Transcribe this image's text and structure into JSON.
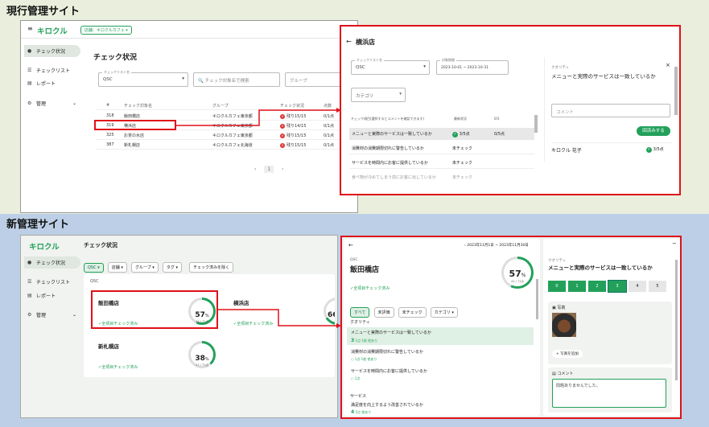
{
  "section_old": {
    "title": "現行管理サイト"
  },
  "section_new": {
    "title": "新管理サイト"
  },
  "old": {
    "logo": "キロクル",
    "shop_chip": "店舗：キロクルカフェ ▾",
    "menu_icon": "hamburger-icon",
    "sidebar": [
      {
        "label": "チェック状況",
        "icon": "check-circle-icon",
        "selected": true
      },
      {
        "label": "チェックリスト",
        "icon": "list-icon"
      },
      {
        "label": "レポート",
        "icon": "document-icon"
      },
      {
        "label": "管理",
        "icon": "gear-icon"
      }
    ],
    "title": "チェック状況",
    "checklist_label": "チェックリスト名",
    "checklist_value": "QSC",
    "search_placeholder": "チェック対象名で検索",
    "group_placeholder": "グループ",
    "headers": [
      "#",
      "チェック対象名",
      "グループ",
      "チェック状況",
      "点数"
    ],
    "rows": [
      {
        "id": "318",
        "name": "飯田橋店",
        "group": "キロクルカフェ東京都",
        "status": "残り15/15",
        "score": "0/1点"
      },
      {
        "id": "319",
        "name": "横浜店",
        "group": "キロクルカフェ東京都",
        "status": "残り14/15",
        "score": "0/1点"
      },
      {
        "id": "325",
        "name": "お茶の水店",
        "group": "キロクルカフェ東京都",
        "status": "残り15/15",
        "score": "0/1点"
      },
      {
        "id": "387",
        "name": "新札幌店",
        "group": "キロクルカフェ北海道",
        "status": "残り15/15",
        "score": "0/1点"
      }
    ],
    "page": "1",
    "detail": {
      "title": "横浜店",
      "checklist_label": "チェックリスト名",
      "checklist_value": "QSC",
      "period_label": "対象期間",
      "period_value": "2023-10-01 ~ 2023-10-31",
      "category_placeholder": "カテゴリ",
      "col_item": "チェック項目(選択するとコメントを確認できます)",
      "col_status": "最新状況",
      "col_points": "0/3",
      "items": [
        {
          "label": "メニューと実際のサービスは一致しているか",
          "status": "3/5点",
          "points": "0/5点"
        },
        {
          "label": "消費材の消費期限切れに警告しているか",
          "status": "未チェック",
          "points": ""
        },
        {
          "label": "サービスを時間内にお客に提供しているか",
          "status": "未チェック",
          "points": ""
        },
        {
          "label": "食べ物が冷めてしまう前にお客に出しているか",
          "status": "未チェック",
          "points": ""
        }
      ],
      "panel_category": "クオリティ",
      "panel_question": "メニューと実際のサービスは一致しているか",
      "comment_placeholder": "コメント",
      "ack_button": "回済みする",
      "reviewer": "キロクル 花子",
      "reviewer_score": "3/5点"
    }
  },
  "new": {
    "logo": "キロクル",
    "title": "チェック状況",
    "sidebar": [
      {
        "label": "チェック状況",
        "icon": "check-circle-icon",
        "selected": true
      },
      {
        "label": "チェックリスト",
        "icon": "list-icon"
      },
      {
        "label": "レポート",
        "icon": "document-icon"
      },
      {
        "label": "管理",
        "icon": "gear-icon"
      }
    ],
    "filters": [
      "QSC ▾",
      "店舗 ▾",
      "グループ ▾",
      "タグ ▾"
    ],
    "exclude_button": "チェック済みを除く",
    "list_label": "QSC",
    "cards": [
      {
        "name": "飯田橋店",
        "percent": "57",
        "sub": "41 / 71点",
        "done": "✓全項目チェック済み",
        "fill": 0.57
      },
      {
        "name": "横浜店",
        "percent": "66",
        "sub": "",
        "done": "✓全項目チェック済み",
        "fill": 0.66
      },
      {
        "name": "新札幌店",
        "percent": "38",
        "sub": "27 / 71点",
        "done": "✓全項目チェック済み",
        "fill": 0.38
      }
    ],
    "detail": {
      "period": "2023年11月1日 ~ 2023年11月30日",
      "checklist": "QSC",
      "shop": "飯田橋店",
      "percent": "57",
      "sub": "41 / 71点",
      "done": "✓全項目チェック済み",
      "tabs": [
        "すべて",
        "未評価",
        "未チェック",
        "カテゴリ ▾"
      ],
      "cat1": "クオリティ",
      "items": [
        {
          "label": "メニューと実際のサービスは一致しているか",
          "score": "3",
          "meta": "1点 1枚 他あり"
        },
        {
          "label": "消費材の消費期限切れに警告しているか",
          "score": "",
          "meta": "1点 1枚 他あり"
        },
        {
          "label": "サービスを時間内にお客に提供しているか",
          "score": "",
          "meta": "1点"
        }
      ],
      "cat2": "サービス",
      "items2": [
        {
          "label": "満足度を向上するよう改善されているか",
          "score": "4",
          "meta": "5点 他あり"
        }
      ],
      "panel_category": "クオリティ",
      "panel_question": "メニューと実際のサービスは一致しているか",
      "scale": [
        "0",
        "1",
        "2",
        "3",
        "4",
        "5"
      ],
      "scale_selected": 3,
      "photo_label": "写真",
      "add_photo": "+ 写真を追加",
      "comment_label": "コメント",
      "comment_value": "問題ありませんでした。"
    }
  },
  "colors": {
    "accent": "#22a05a",
    "red": "#e0101a",
    "old_bg": "#e9efdc",
    "new_bg": "#bccfe6"
  }
}
